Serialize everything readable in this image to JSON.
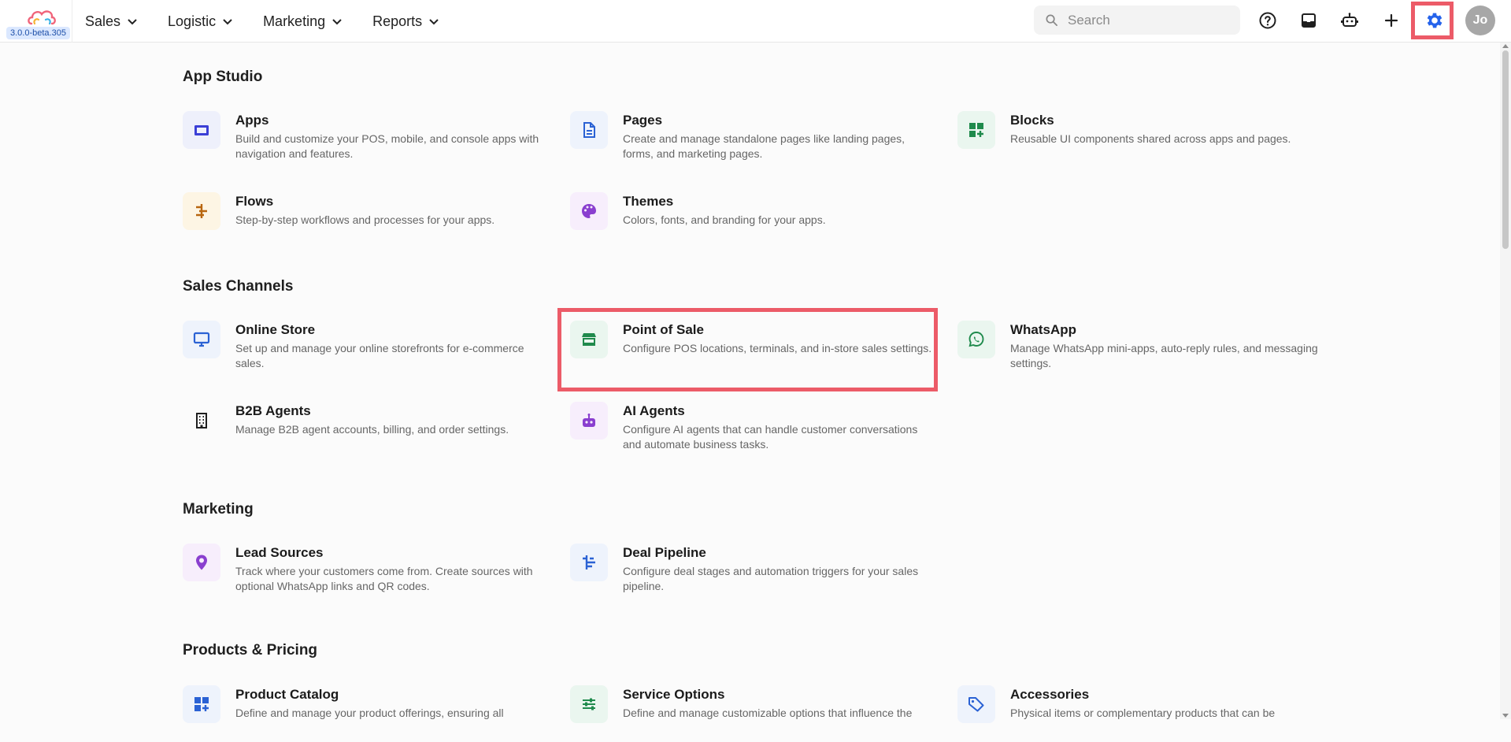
{
  "app": {
    "version": "3.0.0-beta.305",
    "colors": {
      "accent_frame": "#ec5b68",
      "gear_blue": "#2563eb"
    }
  },
  "nav": {
    "items": [
      {
        "label": "Sales",
        "icon": "chevron-down-icon"
      },
      {
        "label": "Logistic",
        "icon": "chevron-down-icon"
      },
      {
        "label": "Marketing",
        "icon": "chevron-down-icon"
      },
      {
        "label": "Reports",
        "icon": "chevron-down-icon"
      }
    ]
  },
  "search": {
    "placeholder": "Search",
    "value": ""
  },
  "toolbar": {
    "buttons": [
      "help-icon",
      "inbox-icon",
      "robot-icon",
      "plus-icon",
      "gear-icon"
    ],
    "avatar_initials": "Jo"
  },
  "sections": [
    {
      "title": "App Studio",
      "cards": [
        {
          "title": "Apps",
          "desc": "Build and customize your POS, mobile, and console apps with navigation and features.",
          "icon": "window-icon"
        },
        {
          "title": "Pages",
          "desc": "Create and manage standalone pages like landing pages, forms, and marketing pages.",
          "icon": "document-icon"
        },
        {
          "title": "Blocks",
          "desc": "Reusable UI components shared across apps and pages.",
          "icon": "blocks-icon"
        },
        {
          "title": "Flows",
          "desc": "Step-by-step workflows and processes for your apps.",
          "icon": "flow-icon"
        },
        {
          "title": "Themes",
          "desc": "Colors, fonts, and branding for your apps.",
          "icon": "palette-icon"
        }
      ]
    },
    {
      "title": "Sales Channels",
      "cards": [
        {
          "title": "Online Store",
          "desc": "Set up and manage your online storefronts for e-commerce sales.",
          "icon": "monitor-icon"
        },
        {
          "title": "Point of Sale",
          "desc": "Configure POS locations, terminals, and in-store sales settings.",
          "icon": "storefront-icon"
        },
        {
          "title": "WhatsApp",
          "desc": "Manage WhatsApp mini-apps, auto-reply rules, and messaging settings.",
          "icon": "whatsapp-icon"
        },
        {
          "title": "B2B Agents",
          "desc": "Manage B2B agent accounts, billing, and order settings.",
          "icon": "building-icon"
        },
        {
          "title": "AI Agents",
          "desc": "Configure AI agents that can handle customer conversations and automate business tasks.",
          "icon": "robot-icon"
        }
      ]
    },
    {
      "title": "Marketing",
      "cards": [
        {
          "title": "Lead Sources",
          "desc": "Track where your customers come from. Create sources with optional WhatsApp links and QR codes.",
          "icon": "location-pin-icon"
        },
        {
          "title": "Deal Pipeline",
          "desc": "Configure deal stages and automation triggers for your sales pipeline.",
          "icon": "pipeline-icon"
        }
      ]
    },
    {
      "title": "Products & Pricing",
      "cards": [
        {
          "title": "Product Catalog",
          "desc": "Define and manage your product offerings, ensuring all",
          "icon": "catalog-icon"
        },
        {
          "title": "Service Options",
          "desc": "Define and manage customizable options that influence the",
          "icon": "sliders-icon"
        },
        {
          "title": "Accessories",
          "desc": "Physical items or complementary products that can be",
          "icon": "tag-icon"
        }
      ]
    }
  ]
}
